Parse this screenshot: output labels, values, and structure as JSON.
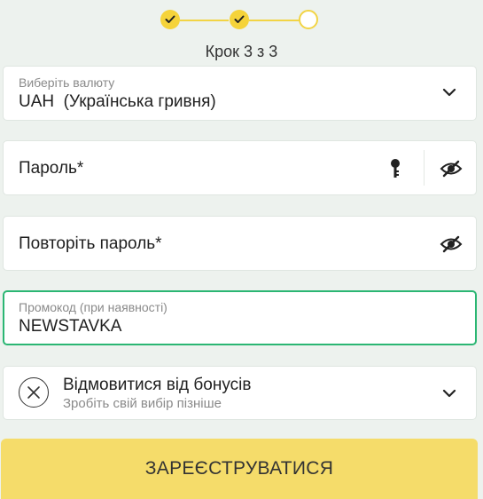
{
  "stepper": {
    "label": "Крок 3 з 3",
    "steps": [
      {
        "state": "done",
        "icon": "check-icon"
      },
      {
        "state": "done",
        "icon": "check-icon"
      },
      {
        "state": "current",
        "icon": ""
      }
    ],
    "accent": "#f5d33a"
  },
  "currency": {
    "label": "Виберіть валюту",
    "value": "UAH  (Українська гривня)",
    "icon": "chevron-down-icon"
  },
  "password": {
    "placeholder": "Пароль*",
    "icons": [
      "key-icon",
      "eye-hidden-icon"
    ]
  },
  "password_repeat": {
    "placeholder": "Повторіть пароль*",
    "icons": [
      "eye-hidden-icon"
    ]
  },
  "promo": {
    "label": "Промокод (при наявності)",
    "value": "NEWSTAVKA",
    "border_color": "#2bb673"
  },
  "bonus": {
    "title": "Відмовитися від бонусів",
    "subtitle": "Зробіть свій вибір пізніше",
    "icons": [
      "close-circle-icon",
      "chevron-down-icon"
    ]
  },
  "submit": {
    "label": "ЗАРЕЄСТРУВАТИСЯ",
    "color": "#f5dc6a"
  }
}
